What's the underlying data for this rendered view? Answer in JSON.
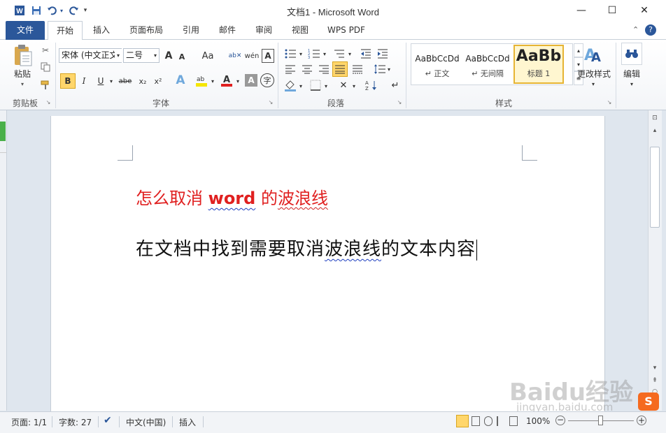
{
  "window": {
    "title": "文档1 - Microsoft Word",
    "minimize_glyph": "—",
    "maximize_glyph": "☐",
    "close_glyph": "✕"
  },
  "tabs": {
    "file": "文件",
    "home": "开始",
    "insert": "插入",
    "page_layout": "页面布局",
    "references": "引用",
    "mailings": "邮件",
    "review": "审阅",
    "view": "视图",
    "wps_pdf": "WPS PDF"
  },
  "ribbon": {
    "clipboard": {
      "paste_label": "粘贴",
      "group_label": "剪贴板"
    },
    "font": {
      "font_name": "宋体 (中文正文",
      "font_size": "二号",
      "grow": "A",
      "shrink": "A",
      "change_case": "Aa",
      "bold": "B",
      "italic": "I",
      "underline": "U",
      "strikethrough": "abe",
      "subscript": "x₂",
      "superscript": "x²",
      "group_label": "字体"
    },
    "paragraph": {
      "group_label": "段落"
    },
    "styles": {
      "normal_preview": "AaBbCcDd",
      "normal_label": "↵ 正文",
      "nospacing_preview": "AaBbCcDd",
      "nospacing_label": "↵ 无间隔",
      "heading_preview": "AaBb",
      "heading_label": "标题 1",
      "change_styles": "更改样式",
      "group_label": "样式"
    },
    "editing": {
      "label": "编辑"
    }
  },
  "document": {
    "heading_part1": "怎么取消 ",
    "heading_part2": "word",
    "heading_part3": " 的",
    "heading_part4": "波浪线",
    "body_part1": "在文档中找到需要取消",
    "body_part2": "波浪线",
    "body_part3": "的文本内容"
  },
  "statusbar": {
    "page": "页面: 1/1",
    "words": "字数: 27",
    "language": "中文(中国)",
    "mode": "插入",
    "zoom": "100%",
    "zoom_level": 1.0
  },
  "watermark": {
    "text": "Baidu经验",
    "url": "jingyan.baidu.com"
  },
  "colors": {
    "file_tab": "#2b579a",
    "heading_red": "#e02020",
    "accent_blue": "#2b579a"
  }
}
